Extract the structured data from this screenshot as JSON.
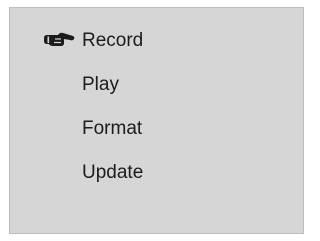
{
  "menu": {
    "selected_index": 0,
    "selected_icon": "pointing-hand-icon",
    "items": [
      {
        "label": "Record"
      },
      {
        "label": "Play"
      },
      {
        "label": "Format"
      },
      {
        "label": "Update"
      }
    ]
  },
  "colors": {
    "screen_background": "#d6d6d6",
    "text": "#1c1c1c"
  }
}
